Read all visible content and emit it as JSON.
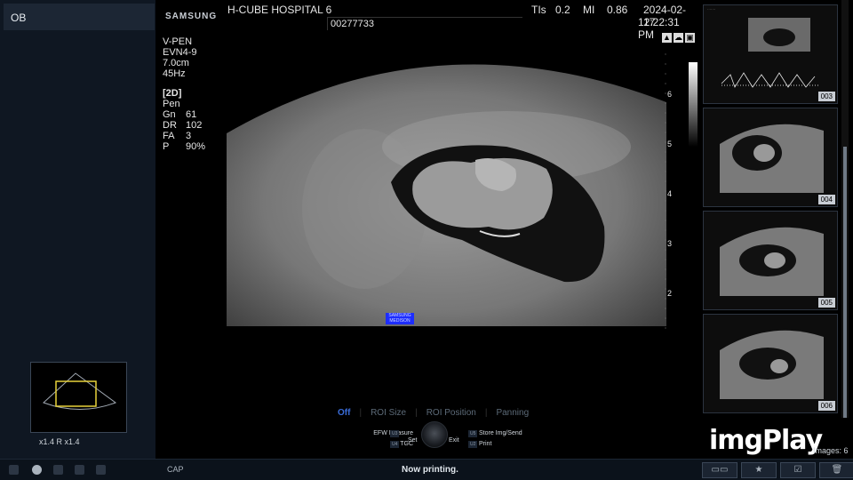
{
  "left_panel": {
    "mode": "OB",
    "zoom_text": "x1.4  R x1.4"
  },
  "header": {
    "brand": "SAMSUNG",
    "hospital": "H-CUBE HOSPITAL 6",
    "patient_id": "00277733",
    "tis_label": "TIs",
    "tis_value": "0.2",
    "mi_label": "MI",
    "mi_value": "0.86",
    "date": "2024-02-17",
    "time": "12:22:31 PM"
  },
  "probe": {
    "lines": [
      "V-PEN",
      "EVN4-9",
      "7.0cm",
      "45Hz"
    ]
  },
  "imaging_params": {
    "mode_title": "[2D]",
    "preset": "Pen",
    "rows": [
      {
        "k": "Gn",
        "v": "61"
      },
      {
        "k": "DR",
        "v": "102"
      },
      {
        "k": "FA",
        "v": "3"
      },
      {
        "k": "P",
        "v": "90%"
      }
    ]
  },
  "depth_scale": [
    "6",
    "5",
    "4",
    "3",
    "2"
  ],
  "thumbnails": [
    {
      "num": "003"
    },
    {
      "num": "004"
    },
    {
      "num": "005"
    },
    {
      "num": "006"
    }
  ],
  "tabs": [
    {
      "label": "Off",
      "active": true
    },
    {
      "label": "ROI Size",
      "active": false
    },
    {
      "label": "ROI Position",
      "active": false
    },
    {
      "label": "Panning",
      "active": false
    }
  ],
  "controls": {
    "efw": "EFW Measure",
    "tgc": "TGC",
    "set": "Set",
    "exit": "Exit",
    "store": "Store Img/Send",
    "print": "Print",
    "badge_u3": "U3",
    "badge_u4": "U4",
    "badge_u5": "U5",
    "badge_u2": "U2"
  },
  "status": {
    "cap": "CAP",
    "message": "Now printing.",
    "images_label": "Images: 6"
  },
  "watermark": "imgPlay",
  "colors": {
    "accent_blue": "#3a6cd8",
    "panel": "#0f1722"
  }
}
